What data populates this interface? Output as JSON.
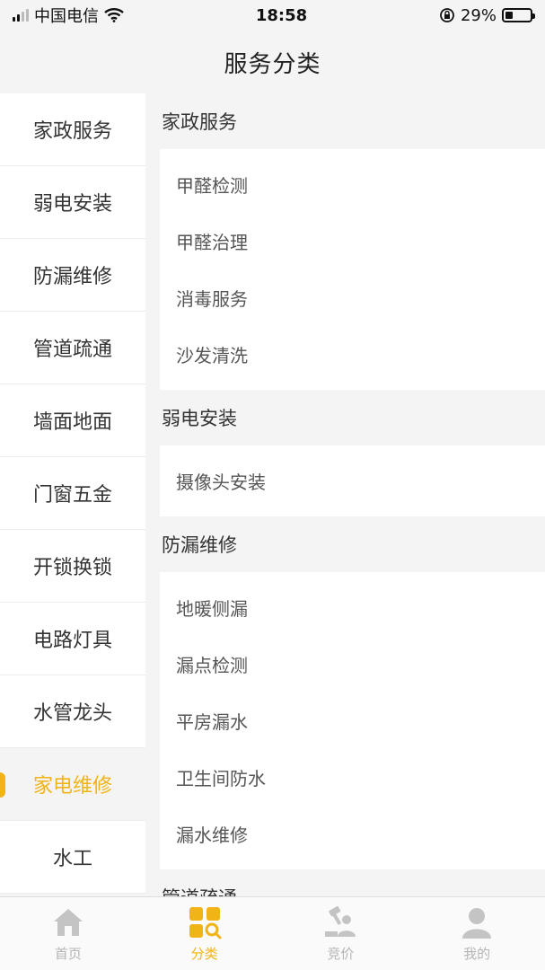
{
  "status_bar": {
    "carrier": "中国电信",
    "time": "18:58",
    "battery": "29%",
    "battery_level": 0.29
  },
  "nav": {
    "title": "服务分类"
  },
  "sidebar": {
    "items": [
      {
        "label": "家政服务"
      },
      {
        "label": "弱电安装"
      },
      {
        "label": "防漏维修"
      },
      {
        "label": "管道疏通"
      },
      {
        "label": "墙面地面"
      },
      {
        "label": "门窗五金"
      },
      {
        "label": "开锁换锁"
      },
      {
        "label": "电路灯具"
      },
      {
        "label": "水管龙头"
      },
      {
        "label": "家电维修"
      },
      {
        "label": "水工"
      }
    ],
    "active_index": 9
  },
  "content": {
    "groups": [
      {
        "title": "家政服务",
        "items": [
          "甲醛检测",
          "甲醛治理",
          "消毒服务",
          "沙发清洗"
        ]
      },
      {
        "title": "弱电安装",
        "items": [
          "摄像头安装"
        ]
      },
      {
        "title": "防漏维修",
        "items": [
          "地暖侧漏",
          "漏点检测",
          "平房漏水",
          "卫生间防水",
          "漏水维修"
        ]
      },
      {
        "title": "管道疏通",
        "items": []
      }
    ]
  },
  "tabbar": {
    "tabs": [
      {
        "label": "首页",
        "icon": "home-icon"
      },
      {
        "label": "分类",
        "icon": "category-icon"
      },
      {
        "label": "竞价",
        "icon": "bid-icon"
      },
      {
        "label": "我的",
        "icon": "user-icon"
      }
    ],
    "active_index": 1
  },
  "colors": {
    "accent": "#f0b417",
    "inactive": "#b5b5b5"
  }
}
